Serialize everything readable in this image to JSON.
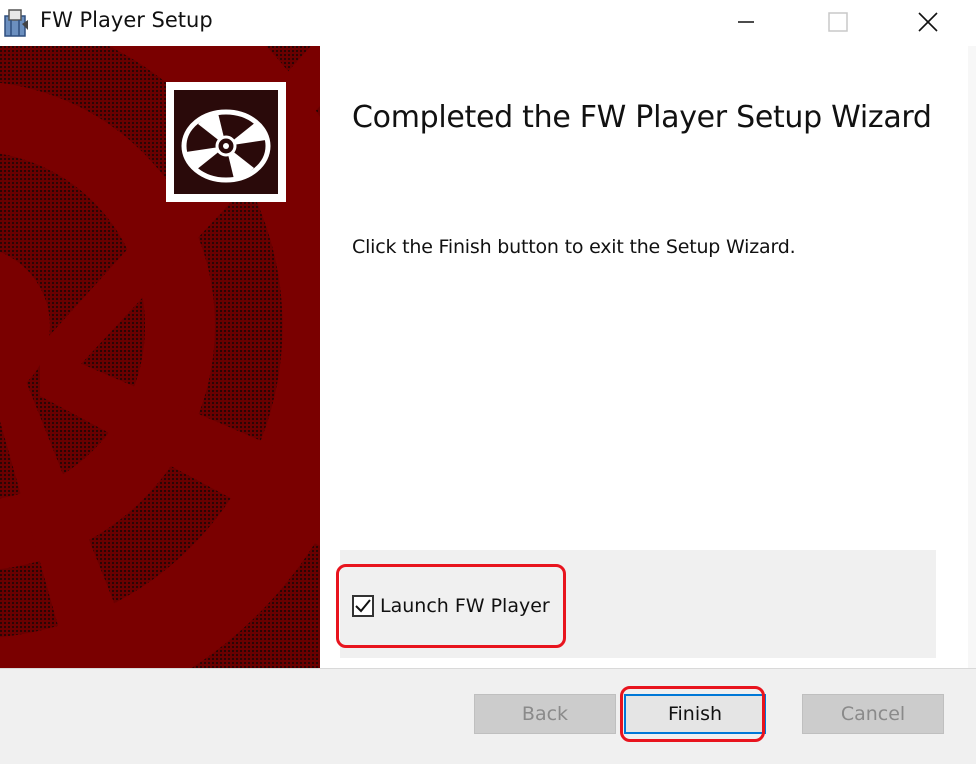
{
  "window": {
    "title": "FW Player Setup",
    "icon": "installer-icon",
    "controls": [
      "minimize-icon",
      "maximize-icon",
      "close-icon"
    ]
  },
  "banner": {
    "icon": "disc-icon",
    "background_color": "#7a0000"
  },
  "content": {
    "heading": "Completed the FW Player Setup Wizard",
    "instruction": "Click the Finish button to exit the Setup Wizard.",
    "launch_checkbox": {
      "label": "Launch FW Player",
      "checked": true
    }
  },
  "buttons": {
    "back": "Back",
    "finish": "Finish",
    "cancel": "Cancel"
  },
  "colors": {
    "highlight": "#e8141e",
    "focus": "#0078d7"
  }
}
